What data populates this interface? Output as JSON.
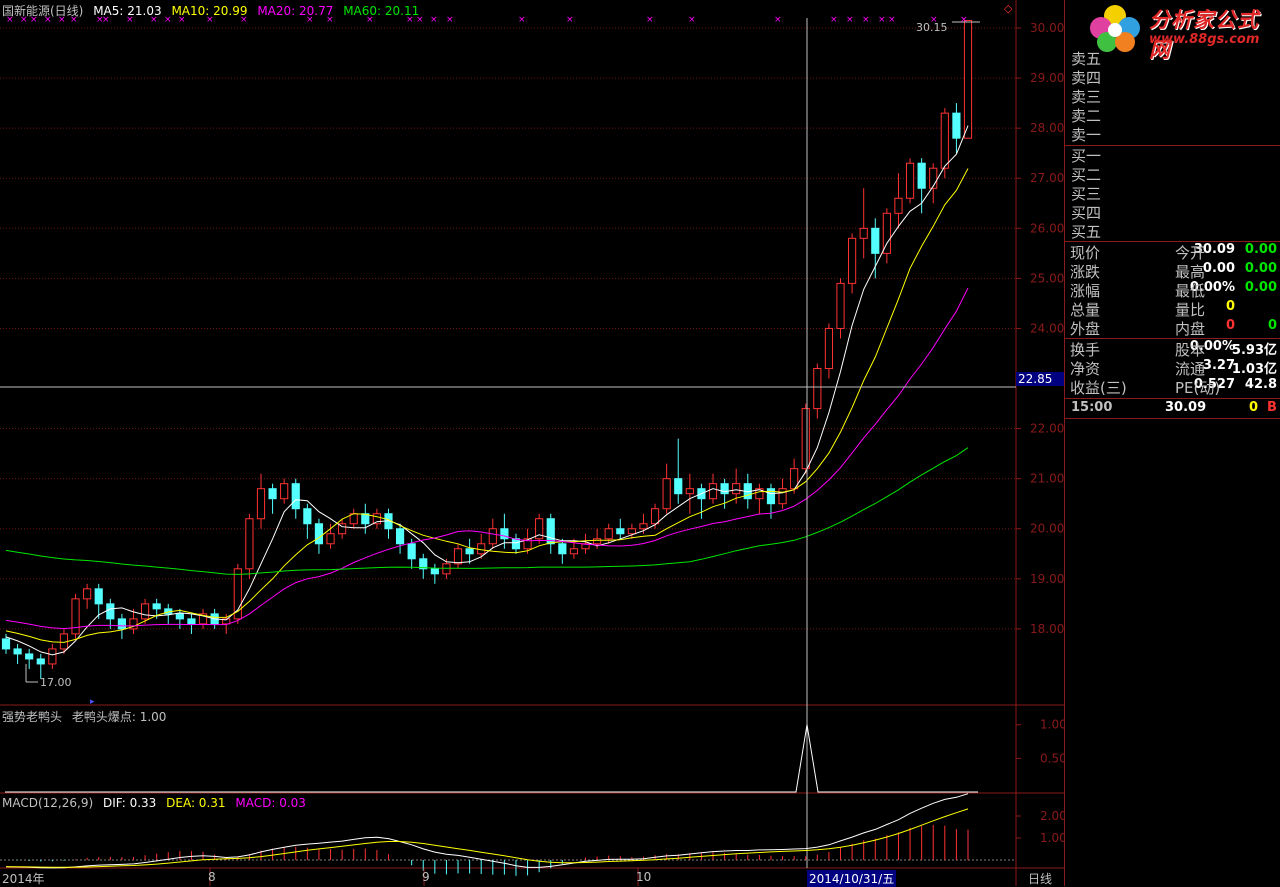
{
  "header": {
    "title": "国新能源(日线)",
    "ma5": "MA5: 21.03",
    "ma10": "MA10: 20.99",
    "ma20": "MA20: 20.77",
    "ma60": "MA60: 20.11"
  },
  "indicator1": {
    "title": "强势老鸭头",
    "label": "老鸭头爆点: 1.00"
  },
  "macd": {
    "title": "MACD(12,26,9)",
    "dif": "DIF: 0.33",
    "dea": "DEA: 0.31",
    "macd": "MACD: 0.03"
  },
  "x_axis_labels": {
    "start": "2014年",
    "aug": "8",
    "sep": "9",
    "oct": "10",
    "cursor_date": "2014/10/31/五",
    "period": "日线"
  },
  "crosshair_price": "22.85",
  "annotations": {
    "high": "30.15",
    "low": "17.00"
  },
  "logo": {
    "name": "分析家公式网",
    "url": "www.88gs.com"
  },
  "quote": {
    "sell": [
      "卖五",
      "卖四",
      "卖三",
      "卖二",
      "卖一"
    ],
    "buy": [
      "买一",
      "买二",
      "买三",
      "买四",
      "买五"
    ],
    "stats": [
      {
        "l1": "现价",
        "v1": "30.09",
        "l2": "今开",
        "v2": "0.00"
      },
      {
        "l1": "涨跌",
        "v1": "0.00",
        "l2": "最高",
        "v2": "0.00"
      },
      {
        "l1": "涨幅",
        "v1": "0.00%",
        "l2": "最低",
        "v2": "0.00"
      },
      {
        "l1": "总量",
        "v1": "0",
        "l2": "量比",
        "v2": ""
      },
      {
        "l1": "外盘",
        "v1": "0",
        "l2": "内盘",
        "v2": "0"
      }
    ],
    "stats2": [
      {
        "l1": "换手",
        "v1": "0.00%",
        "l2": "股本",
        "v2": "5.93亿"
      },
      {
        "l1": "净资",
        "v1": "3.27",
        "l2": "流通",
        "v2": "1.03亿"
      },
      {
        "l1": "收益(三)",
        "v1": "0.527",
        "l2": "PE(动)",
        "v2": "42.8"
      }
    ],
    "tick": {
      "time": "15:00",
      "price": "30.09",
      "vol": "0",
      "flag": "B"
    }
  },
  "colors": {
    "up": "#ff3232",
    "down": "#54ffff",
    "ma5": "#ffffff",
    "ma10": "#ffff00",
    "ma20": "#ff00ff",
    "ma60": "#00e600",
    "grid": "#8b1a1a"
  },
  "chart_data": {
    "type": "candlestick",
    "y_ticks": [
      18.0,
      19.0,
      20.0,
      21.0,
      22.0,
      24.0,
      25.0,
      26.0,
      27.0,
      28.0,
      29.0,
      30.0
    ],
    "ylim": [
      16.5,
      30.2
    ],
    "candles": [
      [
        17.8,
        17.6,
        17.9,
        17.5
      ],
      [
        17.6,
        17.5,
        17.7,
        17.3
      ],
      [
        17.5,
        17.4,
        17.6,
        17.2
      ],
      [
        17.4,
        17.3,
        17.5,
        17.0
      ],
      [
        17.3,
        17.6,
        17.7,
        17.2
      ],
      [
        17.6,
        17.9,
        18.0,
        17.5
      ],
      [
        17.9,
        18.6,
        18.7,
        17.8
      ],
      [
        18.6,
        18.8,
        18.9,
        18.4
      ],
      [
        18.8,
        18.5,
        18.9,
        18.2
      ],
      [
        18.5,
        18.2,
        18.6,
        18.0
      ],
      [
        18.2,
        18.0,
        18.3,
        17.8
      ],
      [
        18.0,
        18.2,
        18.4,
        17.9
      ],
      [
        18.2,
        18.5,
        18.6,
        18.1
      ],
      [
        18.5,
        18.4,
        18.6,
        18.2
      ],
      [
        18.4,
        18.3,
        18.5,
        18.1
      ],
      [
        18.3,
        18.2,
        18.4,
        18.0
      ],
      [
        18.2,
        18.1,
        18.3,
        17.9
      ],
      [
        18.1,
        18.3,
        18.4,
        18.0
      ],
      [
        18.3,
        18.1,
        18.4,
        18.0
      ],
      [
        18.1,
        18.2,
        18.3,
        17.9
      ],
      [
        18.2,
        19.2,
        19.3,
        18.1
      ],
      [
        19.2,
        20.2,
        20.3,
        19.0
      ],
      [
        20.2,
        20.8,
        21.1,
        20.0
      ],
      [
        20.8,
        20.6,
        20.9,
        20.3
      ],
      [
        20.6,
        20.9,
        21.0,
        20.5
      ],
      [
        20.9,
        20.4,
        21.0,
        20.2
      ],
      [
        20.4,
        20.1,
        20.5,
        19.8
      ],
      [
        20.1,
        19.7,
        20.2,
        19.5
      ],
      [
        19.7,
        19.9,
        20.1,
        19.6
      ],
      [
        19.9,
        20.1,
        20.2,
        19.8
      ],
      [
        20.1,
        20.3,
        20.4,
        20.0
      ],
      [
        20.3,
        20.1,
        20.5,
        19.9
      ],
      [
        20.1,
        20.3,
        20.4,
        20.0
      ],
      [
        20.3,
        20.0,
        20.4,
        19.8
      ],
      [
        20.0,
        19.7,
        20.1,
        19.5
      ],
      [
        19.7,
        19.4,
        19.8,
        19.2
      ],
      [
        19.4,
        19.2,
        19.5,
        19.0
      ],
      [
        19.2,
        19.1,
        19.3,
        18.9
      ],
      [
        19.1,
        19.3,
        19.4,
        19.0
      ],
      [
        19.3,
        19.6,
        19.7,
        19.2
      ],
      [
        19.6,
        19.5,
        19.8,
        19.3
      ],
      [
        19.5,
        19.7,
        19.9,
        19.4
      ],
      [
        19.7,
        20.0,
        20.2,
        19.6
      ],
      [
        20.0,
        19.8,
        20.3,
        19.6
      ],
      [
        19.8,
        19.6,
        19.9,
        19.5
      ],
      [
        19.6,
        19.8,
        20.0,
        19.5
      ],
      [
        19.8,
        20.2,
        20.3,
        19.7
      ],
      [
        20.2,
        19.7,
        20.3,
        19.5
      ],
      [
        19.7,
        19.5,
        19.8,
        19.3
      ],
      [
        19.5,
        19.6,
        19.8,
        19.4
      ],
      [
        19.6,
        19.7,
        19.9,
        19.5
      ],
      [
        19.7,
        19.8,
        20.0,
        19.6
      ],
      [
        19.8,
        20.0,
        20.1,
        19.7
      ],
      [
        20.0,
        19.9,
        20.2,
        19.8
      ],
      [
        19.9,
        20.0,
        20.1,
        19.8
      ],
      [
        20.0,
        20.1,
        20.3,
        19.9
      ],
      [
        20.1,
        20.4,
        20.5,
        20.0
      ],
      [
        20.4,
        21.0,
        21.3,
        20.3
      ],
      [
        21.0,
        20.7,
        21.8,
        20.5
      ],
      [
        20.7,
        20.8,
        21.1,
        20.3
      ],
      [
        20.8,
        20.6,
        20.9,
        20.2
      ],
      [
        20.6,
        20.9,
        21.1,
        20.5
      ],
      [
        20.9,
        20.7,
        21.0,
        20.4
      ],
      [
        20.7,
        20.9,
        21.2,
        20.5
      ],
      [
        20.9,
        20.6,
        21.1,
        20.4
      ],
      [
        20.6,
        20.8,
        20.9,
        20.3
      ],
      [
        20.8,
        20.5,
        20.9,
        20.2
      ],
      [
        20.5,
        20.8,
        21.0,
        20.4
      ],
      [
        20.8,
        21.2,
        21.4,
        20.7
      ],
      [
        21.2,
        22.4,
        22.5,
        21.1
      ],
      [
        22.4,
        23.2,
        23.3,
        22.2
      ],
      [
        23.2,
        24.0,
        24.1,
        23.0
      ],
      [
        24.0,
        24.9,
        25.0,
        23.8
      ],
      [
        24.9,
        25.8,
        25.9,
        24.7
      ],
      [
        25.8,
        26.0,
        26.8,
        25.4
      ],
      [
        26.0,
        25.5,
        26.2,
        25.0
      ],
      [
        25.5,
        26.3,
        26.4,
        25.3
      ],
      [
        26.3,
        26.6,
        27.1,
        26.0
      ],
      [
        26.6,
        27.3,
        27.4,
        26.5
      ],
      [
        27.3,
        26.8,
        27.4,
        26.3
      ],
      [
        26.8,
        27.2,
        27.3,
        26.5
      ],
      [
        27.2,
        28.3,
        28.4,
        27.0
      ],
      [
        28.3,
        27.8,
        28.5,
        27.5
      ],
      [
        27.8,
        30.15,
        30.15,
        27.8
      ]
    ],
    "indicator": {
      "type": "spike",
      "x_index": 70,
      "value": 1.0,
      "ticks": [
        0.5,
        1.0
      ]
    },
    "macd_ticks": [
      1.0,
      2.0
    ]
  }
}
